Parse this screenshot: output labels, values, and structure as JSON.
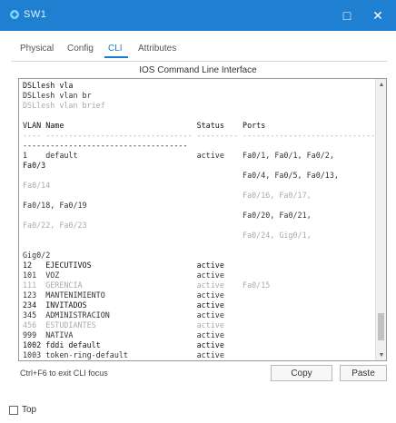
{
  "window": {
    "title": "SW1",
    "maximize_glyph": "□",
    "close_glyph": "✕",
    "title_bar_color": "#1f7fd1"
  },
  "tabs": [
    {
      "label": "Physical"
    },
    {
      "label": "Config"
    },
    {
      "label": "CLI",
      "active": true
    },
    {
      "label": "Attributes"
    }
  ],
  "panel": {
    "title": "IOS Command Line Interface"
  },
  "console": {
    "lines": [
      {
        "text": "DSLlesh vla",
        "style": "bold"
      },
      {
        "text": "DSLlesh vlan br",
        "style": ""
      },
      {
        "text": "DSLlesh vlan brief",
        "style": "dim"
      },
      {
        "text": "",
        "style": ""
      },
      {
        "text": "VLAN Name                             Status    Ports",
        "style": "bold"
      },
      {
        "text": "---- -------------------------------- --------- -------------------------------",
        "style": "dim"
      },
      {
        "text": "------------------------------------",
        "style": "bold"
      },
      {
        "text": "1    default                          active    Fa0/1, Fa0/1, Fa0/2,",
        "style": ""
      },
      {
        "text": "Fa0/3",
        "style": "bold"
      },
      {
        "text": "                                                Fa0/4, Fa0/5, Fa0/13,",
        "style": ""
      },
      {
        "text": "Fa0/14",
        "style": "dim"
      },
      {
        "text": "                                                Fa0/16, Fa0/17,",
        "style": "dim"
      },
      {
        "text": "Fa0/18, Fa0/19",
        "style": ""
      },
      {
        "text": "                                                Fa0/20, Fa0/21,",
        "style": ""
      },
      {
        "text": "Fa0/22, Fa0/23",
        "style": "dim"
      },
      {
        "text": "                                                Fa0/24, Gig0/1,",
        "style": "dim"
      },
      {
        "text": "",
        "style": ""
      },
      {
        "text": "Gig0/2",
        "style": ""
      },
      {
        "text": "12   EJECUTIVOS                       active",
        "style": "bold"
      },
      {
        "text": "101  VOZ                              active",
        "style": ""
      },
      {
        "text": "111  GERENCIA                         active    Fa0/15",
        "style": "dim"
      },
      {
        "text": "123  MANTENIMIENTO                    active",
        "style": ""
      },
      {
        "text": "234  INVITADOS                        active",
        "style": "bold"
      },
      {
        "text": "345  ADMINISTRACION                   active",
        "style": ""
      },
      {
        "text": "456  ESTUDIANTES                      active",
        "style": "dim"
      },
      {
        "text": "999  NATIVA                           active",
        "style": ""
      },
      {
        "text": "1002 fddi default                     active",
        "style": "bold"
      },
      {
        "text": "1003 token-ring-default               active",
        "style": ""
      },
      {
        "text": "1004 fddinet-default                  active",
        "style": "dim"
      }
    ]
  },
  "footer": {
    "hint": "Ctrl+F6 to exit CLI focus",
    "copy_label": "Copy",
    "paste_label": "Paste"
  },
  "top_option": {
    "label": "Top",
    "checked": false
  }
}
